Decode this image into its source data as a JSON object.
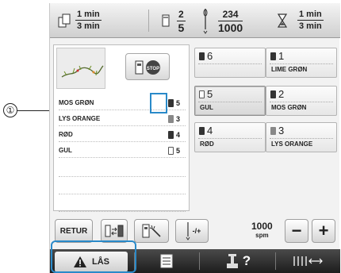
{
  "callout": {
    "number": "①"
  },
  "header": {
    "time1": {
      "numerator": "1 min",
      "denominator": "3 min"
    },
    "color_change": {
      "numerator": "2",
      "denominator": "5"
    },
    "stitch": {
      "numerator": "234",
      "denominator": "1000"
    },
    "time2": {
      "numerator": "1 min",
      "denominator": "3 min"
    }
  },
  "stop_button": {
    "label": "STOP"
  },
  "color_list": [
    {
      "name": "MOS GRØN",
      "needle": "5",
      "spool": "dark"
    },
    {
      "name": "LYS ORANGE",
      "needle": "3",
      "spool": "grey"
    },
    {
      "name": "RØD",
      "needle": "4",
      "spool": "dark"
    },
    {
      "name": "GUL",
      "needle": "5",
      "spool": "white"
    }
  ],
  "needles": [
    {
      "number": "6",
      "color": "",
      "spool": "dark"
    },
    {
      "number": "1",
      "color": "LIME GRØN",
      "spool": "dark"
    },
    {
      "number": "5",
      "color": "GUL",
      "spool": "white"
    },
    {
      "number": "2",
      "color": "MOS GRØN",
      "spool": "dark"
    },
    {
      "number": "4",
      "color": "RØD",
      "spool": "dark"
    },
    {
      "number": "3",
      "color": "LYS ORANGE",
      "spool": "grey"
    }
  ],
  "toolbar": {
    "retur_label": "RETUR",
    "needle_label": "-/+",
    "speed_value": "1000",
    "speed_unit": "spm",
    "minus_label": "−",
    "plus_label": "+"
  },
  "bottom_bar": {
    "lock_label": "LÅS",
    "help_label": "?"
  },
  "colors": {
    "highlight": "#2a8ac9",
    "bottom_bar": "#2b2b2b"
  }
}
